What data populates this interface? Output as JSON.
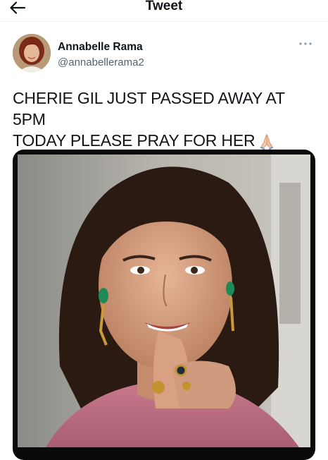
{
  "header": {
    "title": "Tweet",
    "back_icon": "arrow-left-icon"
  },
  "author": {
    "name": "Annabelle Rama",
    "handle": "@annabellerama2",
    "more_icon": "more-horizontal-icon"
  },
  "tweet": {
    "line1": "CHERIE GIL JUST PASSED AWAY AT 5PM",
    "line2": "TODAY PLEASE PRAY FOR HER",
    "emoji_icon": "folded-hands-icon"
  },
  "colors": {
    "text": "#0f1419",
    "secondary": "#536471",
    "divider": "#eff3f4"
  }
}
